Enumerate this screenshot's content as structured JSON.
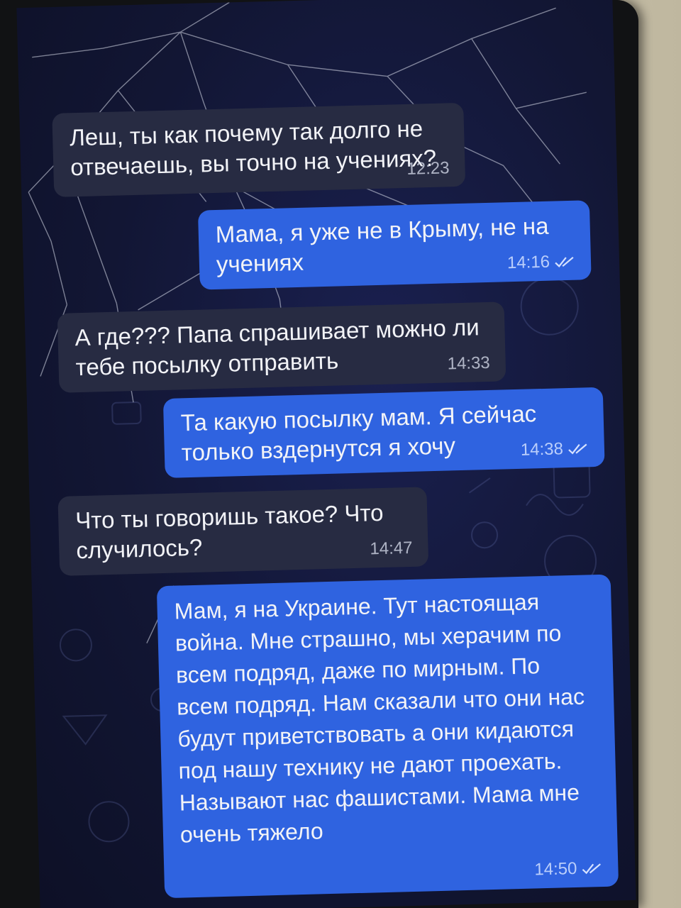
{
  "chat": {
    "messages": [
      {
        "direction": "incoming",
        "text": "Леш, ты как почему так долго не отвечаешь, вы точно на учениях?",
        "time": "12:23"
      },
      {
        "direction": "outgoing",
        "text": "Мама, я уже не в Крыму, не на учениях",
        "time": "14:16",
        "status": "read"
      },
      {
        "direction": "incoming",
        "text": "А где??? Папа спрашивает можно ли тебе посылку отправить",
        "time": "14:33"
      },
      {
        "direction": "outgoing",
        "text": "Та какую посылку мам. Я сейчас только вздернутся я хочу",
        "time": "14:38",
        "status": "read"
      },
      {
        "direction": "incoming",
        "text": "Что ты говоришь такое? Что случилось?",
        "time": "14:47"
      },
      {
        "direction": "outgoing",
        "text": "Мам, я на Украине. Тут настоящая война. Мне страшно, мы херачим по всем подряд, даже по мирным. По всем подряд. Нам сказали что они нас будут приветствовать а они кидаются под нашу технику не дают проехать. Называют нас фашистами. Мама мне очень тяжело",
        "time": "14:50",
        "status": "read"
      }
    ]
  },
  "colors": {
    "incoming_bubble": "#272b42",
    "outgoing_bubble": "#2f63e0",
    "chat_background": "#121634",
    "read_checks": "#d6e2ff"
  },
  "icons": {
    "read_status": "double-check-icon"
  }
}
